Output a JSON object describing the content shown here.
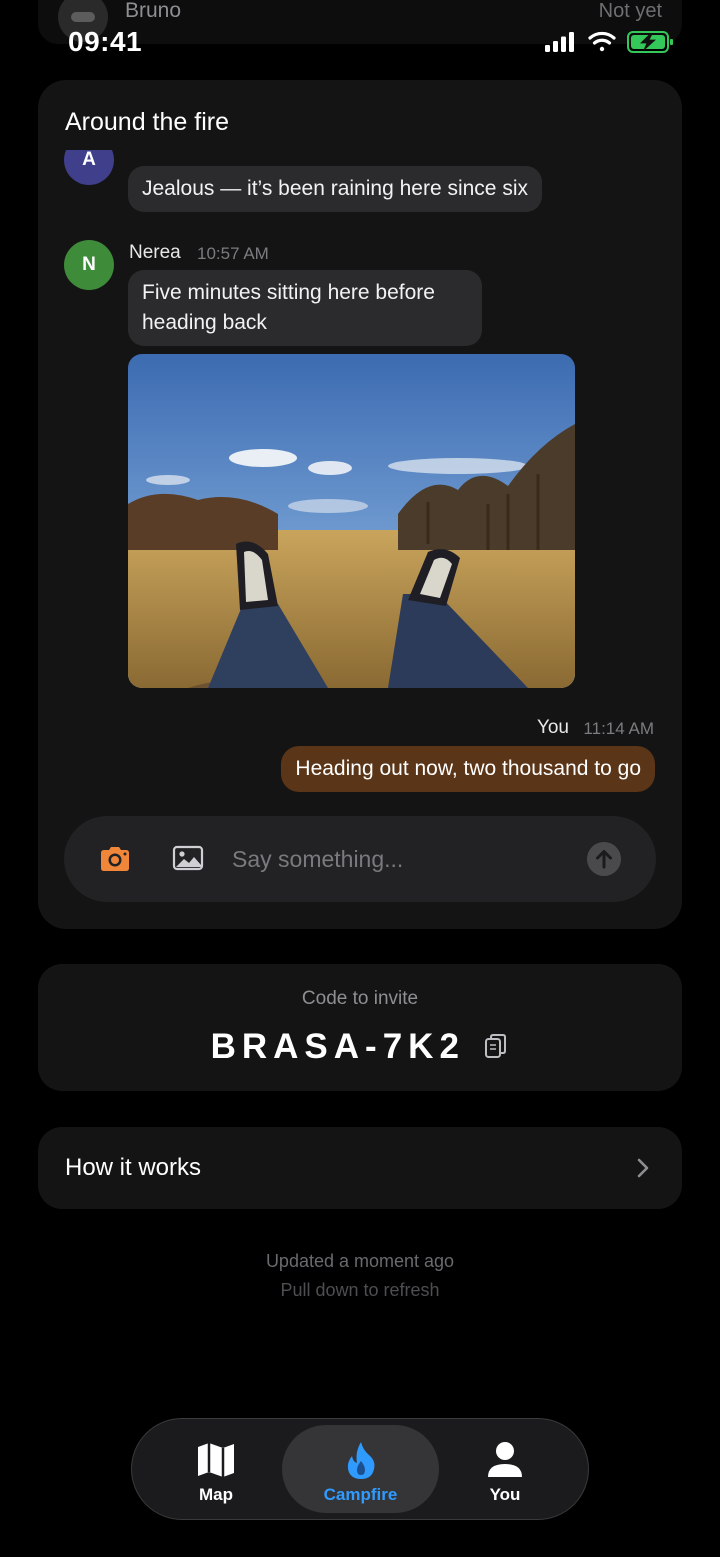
{
  "peek_row": {
    "name": "Bruno",
    "status": "Not yet"
  },
  "status_bar": {
    "time": "09:41"
  },
  "campfire": {
    "title": "Around the fire",
    "messages": [
      {
        "avatar_letter": "A",
        "text": "Jealous — it’s been raining here since six"
      },
      {
        "avatar_letter": "N",
        "sender": "Nerea",
        "time": "10:57 AM",
        "text": "Five minutes sitting here before heading back"
      },
      {
        "sender": "You",
        "time": "11:14 AM",
        "text": "Heading out now, two thousand to go"
      }
    ],
    "composer": {
      "placeholder": "Say something..."
    }
  },
  "invite": {
    "label": "Code to invite",
    "code": "BRASA-7K2"
  },
  "how_it_works": {
    "label": "How it works"
  },
  "footer": {
    "updated": "Updated a moment ago",
    "pull": "Pull down to refresh"
  },
  "tabs": [
    {
      "label": "Map",
      "icon": "map-icon",
      "active": false
    },
    {
      "label": "Campfire",
      "icon": "flame-icon",
      "active": true
    },
    {
      "label": "You",
      "icon": "person-icon",
      "active": false
    }
  ],
  "colors": {
    "accent": "#2f9bff",
    "outgoing_bubble": "#5b3518",
    "camera_orange": "#f0863a",
    "battery_green": "#34c759"
  }
}
